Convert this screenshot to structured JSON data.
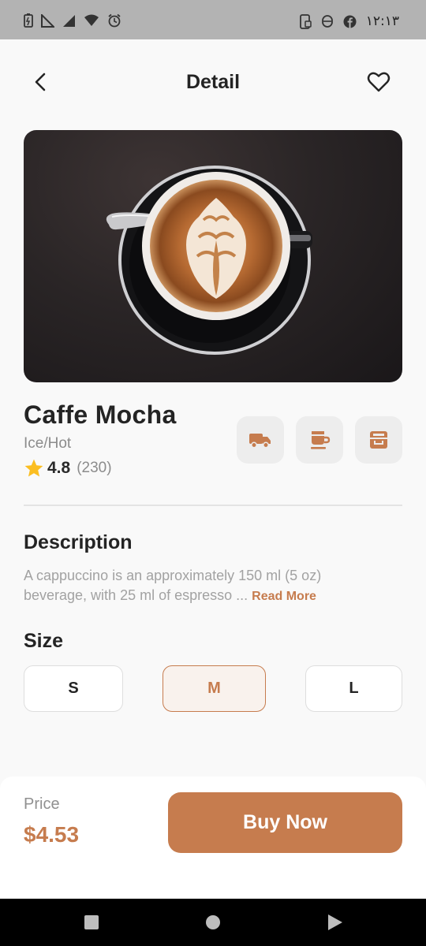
{
  "status_bar": {
    "clock": "١٢:١٣",
    "left_icons": [
      "battery-saver-icon",
      "signal-icon",
      "signal-icon-2",
      "wifi-icon",
      "alarm-icon"
    ],
    "right_icons": [
      "phone-screen-icon",
      "currency-icon",
      "facebook-icon"
    ]
  },
  "header": {
    "title": "Detail",
    "back_icon": "chevron-left-icon",
    "favorite_icon": "heart-icon"
  },
  "product": {
    "name": "Caffe Mocha",
    "variant": "Ice/Hot",
    "rating": "4.8",
    "rating_count": "(230)",
    "features": [
      "delivery-truck-icon",
      "coffee-cup-icon",
      "milk-box-icon"
    ]
  },
  "description": {
    "title": "Description",
    "text": "A cappuccino is an approximately 150 ml (5 oz) beverage, with 25 ml of espresso ... ",
    "read_more": "Read More"
  },
  "size": {
    "title": "Size",
    "options": [
      "S",
      "M",
      "L"
    ],
    "selected": "M"
  },
  "purchase": {
    "price_label": "Price",
    "price_value": "$4.53",
    "buy_label": "Buy Now"
  },
  "colors": {
    "accent": "#c67c4e",
    "accent_light": "#f9f2ed",
    "text_primary": "#242424",
    "text_muted": "#a2a2a2",
    "star": "#fbbe21"
  }
}
